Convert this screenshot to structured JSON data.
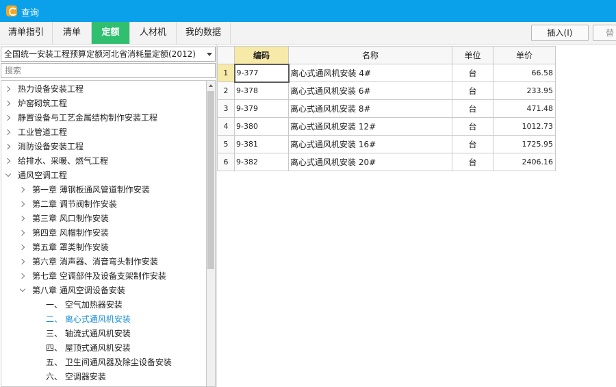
{
  "window": {
    "title": "查询"
  },
  "tabs": [
    {
      "label": "清单指引"
    },
    {
      "label": "清单"
    },
    {
      "label": "定额"
    },
    {
      "label": "人材机"
    },
    {
      "label": "我的数据"
    }
  ],
  "toolbar": {
    "insert_label": "插入(I)",
    "replace_label": "替"
  },
  "quota_select": {
    "value": "全国统一安装工程预算定额河北省消耗量定额(2012)"
  },
  "search": {
    "placeholder": "搜索",
    "value": ""
  },
  "tree": [
    {
      "label": "热力设备安装工程"
    },
    {
      "label": "炉窑砌筑工程"
    },
    {
      "label": "静置设备与工艺金属结构制作安装工程"
    },
    {
      "label": "工业管道工程"
    },
    {
      "label": "消防设备安装工程"
    },
    {
      "label": "给排水、采暖、燃气工程"
    },
    {
      "label": "通风空调工程"
    },
    {
      "label": "第一章 薄钢板通风管道制作安装"
    },
    {
      "label": "第二章 调节阀制作安装"
    },
    {
      "label": "第三章 风口制作安装"
    },
    {
      "label": "第四章 风帽制作安装"
    },
    {
      "label": "第五章 罩类制作安装"
    },
    {
      "label": "第六章 消声器、消音弯头制作安装"
    },
    {
      "label": "第七章 空调部件及设备支架制作安装"
    },
    {
      "label": "第八章 通风空调设备安装"
    },
    {
      "label": "一、 空气加热器安装"
    },
    {
      "label": "二、 离心式通风机安装"
    },
    {
      "label": "三、 轴流式通风机安装"
    },
    {
      "label": "四、 屋顶式通风机安装"
    },
    {
      "label": "五、 卫生间通风器及除尘设备安装"
    },
    {
      "label": "六、 空调器安装"
    }
  ],
  "grid": {
    "headers": {
      "code": "编码",
      "name": "名称",
      "unit": "单位",
      "price": "单价"
    },
    "rows": [
      {
        "no": "1",
        "code": "9-377",
        "name": "离心式通风机安装 4#",
        "unit": "台",
        "price": "66.58"
      },
      {
        "no": "2",
        "code": "9-378",
        "name": "离心式通风机安装 6#",
        "unit": "台",
        "price": "233.95"
      },
      {
        "no": "3",
        "code": "9-379",
        "name": "离心式通风机安装 8#",
        "unit": "台",
        "price": "471.48"
      },
      {
        "no": "4",
        "code": "9-380",
        "name": "离心式通风机安装 12#",
        "unit": "台",
        "price": "1012.73"
      },
      {
        "no": "5",
        "code": "9-381",
        "name": "离心式通风机安装 16#",
        "unit": "台",
        "price": "1725.95"
      },
      {
        "no": "6",
        "code": "9-382",
        "name": "离心式通风机安装 20#",
        "unit": "台",
        "price": "2406.16"
      }
    ]
  },
  "colors": {
    "titlebar": "#0aa0ea",
    "active_tab": "#2fbf6f",
    "selected_tree_item": "#1e90d6",
    "current_cell": "#f7e9a8"
  }
}
